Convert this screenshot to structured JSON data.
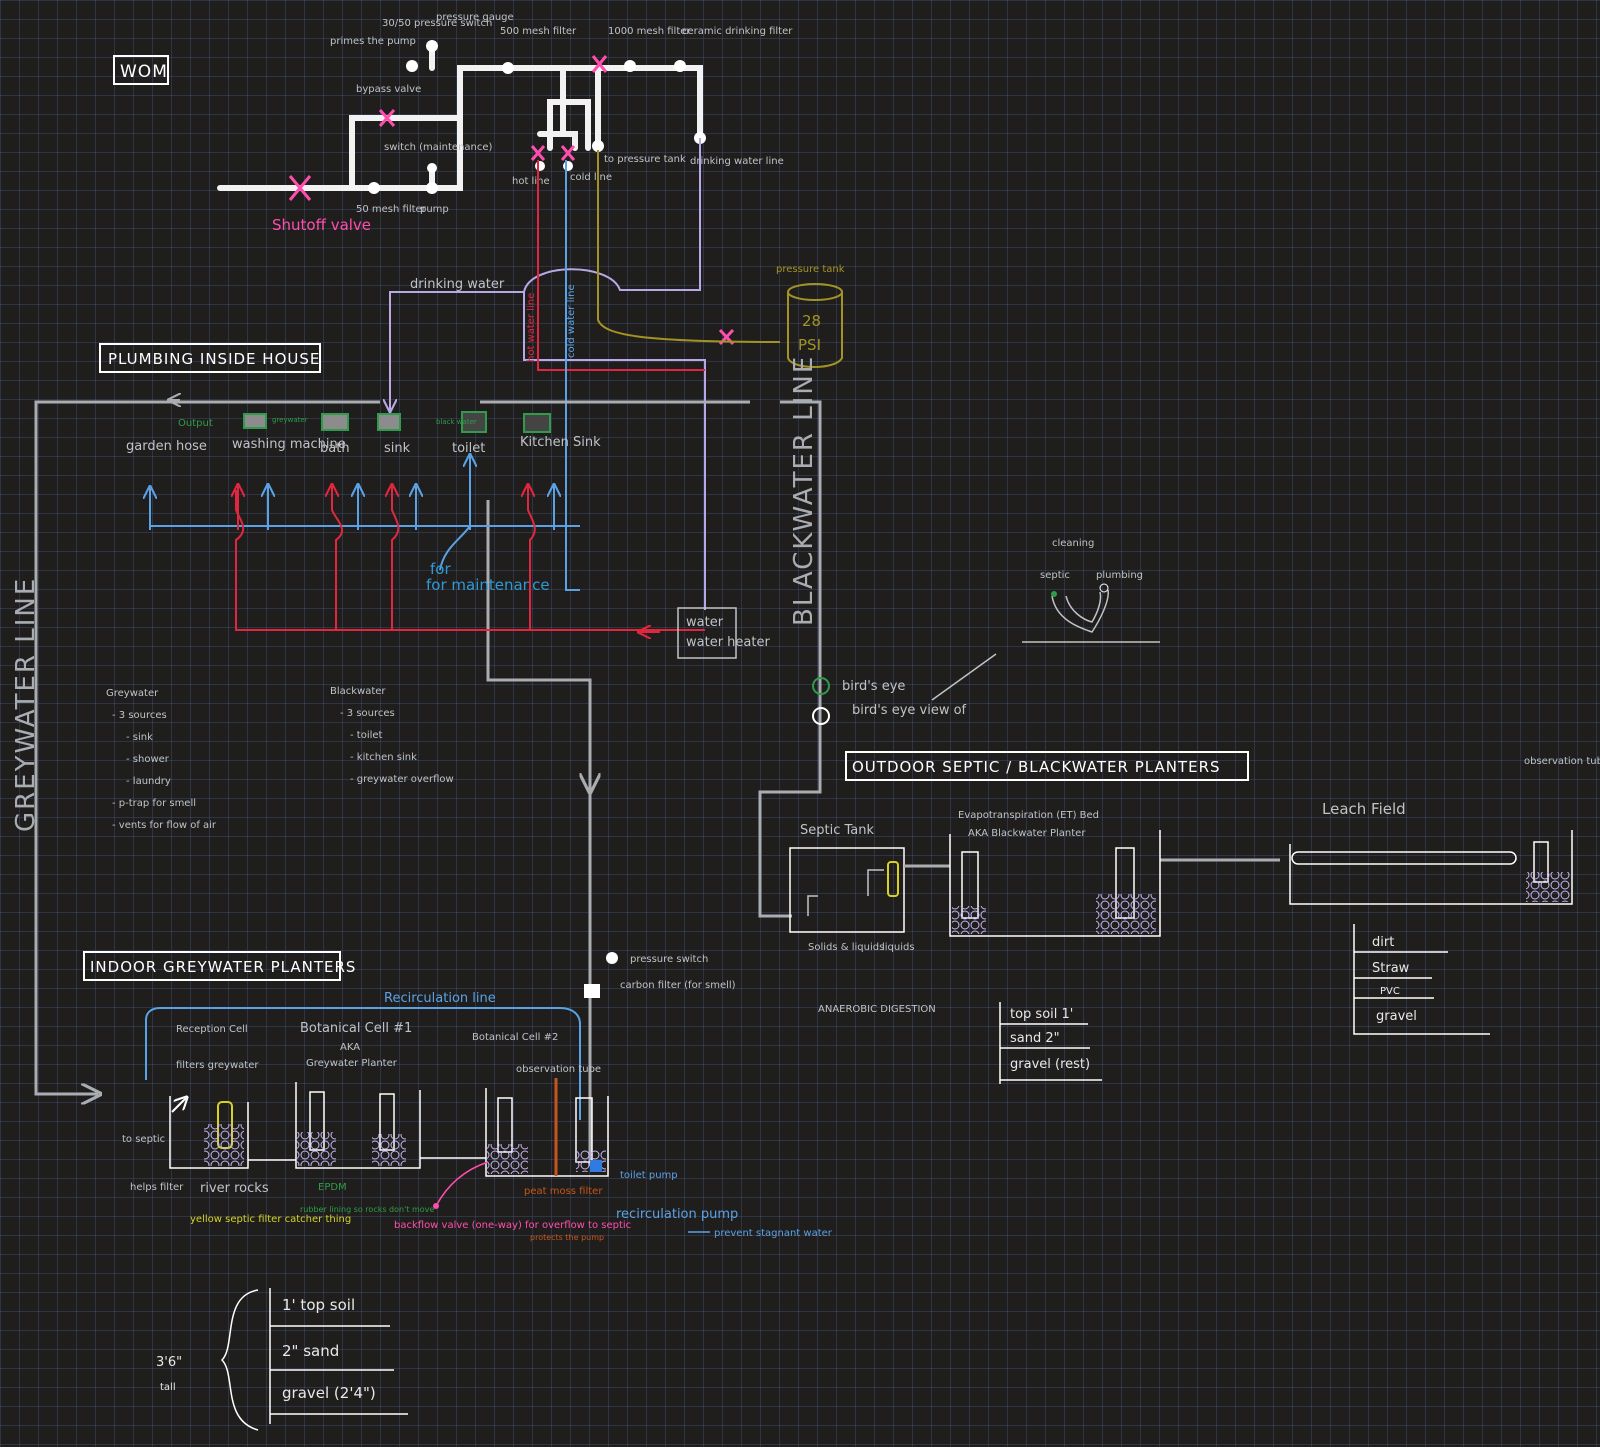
{
  "colors": {
    "background": "#201e1d",
    "grid": "#465f8c",
    "white_line": "#f2f2f2",
    "grey_line": "#a9adb1",
    "cold_line": "#5aa2e6",
    "hot_line": "#e0273f",
    "drinking_line": "#b9a8e6",
    "pressure_line": "#a39322",
    "shutoff_x": "#ff4fae",
    "green": "#2e9c4a",
    "orange": "#c4561c",
    "yellow": "#d7d221"
  },
  "wom": {
    "title": "WOM",
    "labels": {
      "primes": "primes the pump",
      "switch_3050": "30/50 pressure switch",
      "pressure_gauge": "pressure gauge",
      "mesh500": "500 mesh filter",
      "mesh1000": "1000 mesh filter",
      "ceramic": "ceramic drinking filter",
      "bypass": "bypass valve",
      "switch_maint": "switch (maintenance)",
      "hot_line": "hot line",
      "cold_line": "cold line",
      "to_pressure_tank": "to pressure tank",
      "drinking_water_line": "drinking water line",
      "shutoff_valve": "Shutoff valve",
      "mesh50": "50 mesh filter",
      "pump": "pump"
    }
  },
  "pressure_tank": {
    "label": "pressure tank",
    "value": "28",
    "unit": "PSI"
  },
  "plumbing": {
    "title": "PLUMBING INSIDE HOUSE",
    "drinking_water": "drinking water",
    "hot_water_line": "hot water line",
    "cold_water_line": "cold water line",
    "output": "Output",
    "greywater_tag": "greywater",
    "blackwater_tag": "black water",
    "fixtures": [
      "garden hose",
      "washing machine",
      "bath",
      "sink",
      "toilet",
      "Kitchen Sink"
    ],
    "for_maintenance": "for maintenance",
    "water_heater": "water heater"
  },
  "greywater_line": "GREYWATER LINE",
  "blackwater_line": "BLACKWATER LINE",
  "notes": {
    "greywater": {
      "title": "Greywater",
      "lines": [
        "- 3 sources",
        "- sink",
        "- shower",
        "- laundry",
        "- p-trap for smell",
        "- vents for flow of air"
      ]
    },
    "blackwater": {
      "title": "Blackwater",
      "lines": [
        "- 3 sources",
        "- toilet",
        "- kitchen sink",
        "- greywater overflow"
      ]
    }
  },
  "birds_eye": {
    "cleaning": "cleaning",
    "septic": "septic",
    "plumbing": "plumbing",
    "view_label": "bird's eye view of"
  },
  "outdoor": {
    "title": "OUTDOOR SEPTIC / BLACKWATER PLANTERS",
    "septic_tank": "Septic Tank",
    "solids": "Solids & liquids",
    "liquids": "liquids",
    "anaerobic": "ANAEROBIC DIGESTION",
    "et_bed": "Evapotranspiration (ET) Bed",
    "et_aka": "AKA Blackwater Planter",
    "leach_field": "Leach Field",
    "observation_tube": "observation tube",
    "et_layers": [
      "top soil 1'",
      "sand 2\"",
      "gravel (rest)"
    ],
    "leach_layers": [
      "dirt",
      "Straw",
      "PVC",
      "gravel"
    ]
  },
  "indoor": {
    "title": "INDOOR GREYWATER PLANTERS",
    "recirculation_line": "Recirculation line",
    "reception_cell": "Reception Cell",
    "filters_greywater": "filters greywater",
    "cell1": "Botanical Cell #1",
    "cell1_aka": "AKA",
    "cell1_name": "Greywater Planter",
    "cell2": "Botanical Cell #2",
    "observation_tube": "observation tube",
    "pressure_switch": "pressure switch",
    "carbon_filter": "carbon filter (for smell)",
    "to_septic": "to septic",
    "helps_filter": "helps filter",
    "river_rocks": "river rocks",
    "yellow_filter": "yellow septic filter catcher thing",
    "epdm": "EPDM",
    "epdm_note": "rubber lining so rocks don't move",
    "backflow": "backflow valve (one-way) for overflow to septic",
    "peat_moss": "peat moss filter",
    "peat_note": "protects the pump",
    "toilet_pump": "toilet pump",
    "recirc_pump": "recirculation pump",
    "prevent": "prevent stagnant water",
    "height": "3'6\"",
    "tall": "tall",
    "layers": [
      "1' top soil",
      "2\" sand",
      "gravel (2'4\")"
    ]
  }
}
